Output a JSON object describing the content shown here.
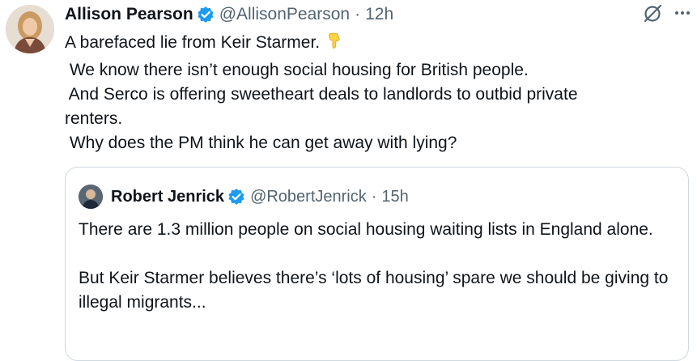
{
  "tweet": {
    "author_name": "Allison Pearson",
    "handle": "@AllisonPearson",
    "separator": "·",
    "time": "12h",
    "more_icon": "more-horizontal-icon",
    "grok_icon": "grok-icon",
    "emoji": "backhand-index-pointing-down-icon",
    "lines": [
      "A barefaced lie from Keir Starmer.",
      " We know there isn’t enough social housing for British people.",
      " And Serco is offering sweetheart deals to landlords to outbid private",
      "renters.",
      " Why does the PM think he can get away with lying?"
    ]
  },
  "quoted_tweet": {
    "author_name": "Robert Jenrick",
    "handle": "@RobertJenrick",
    "separator": "·",
    "time": "15h",
    "paragraph_1": "There are 1.3 million people on social housing waiting lists in England alone.",
    "paragraph_2": "But Keir Starmer believes there’s ‘lots of housing’ spare we should be giving to illegal migrants..."
  },
  "colors": {
    "text": "#0f1419",
    "secondary": "#536471",
    "verified_blue": "#1d9bf0",
    "border": "#cfd9de"
  }
}
